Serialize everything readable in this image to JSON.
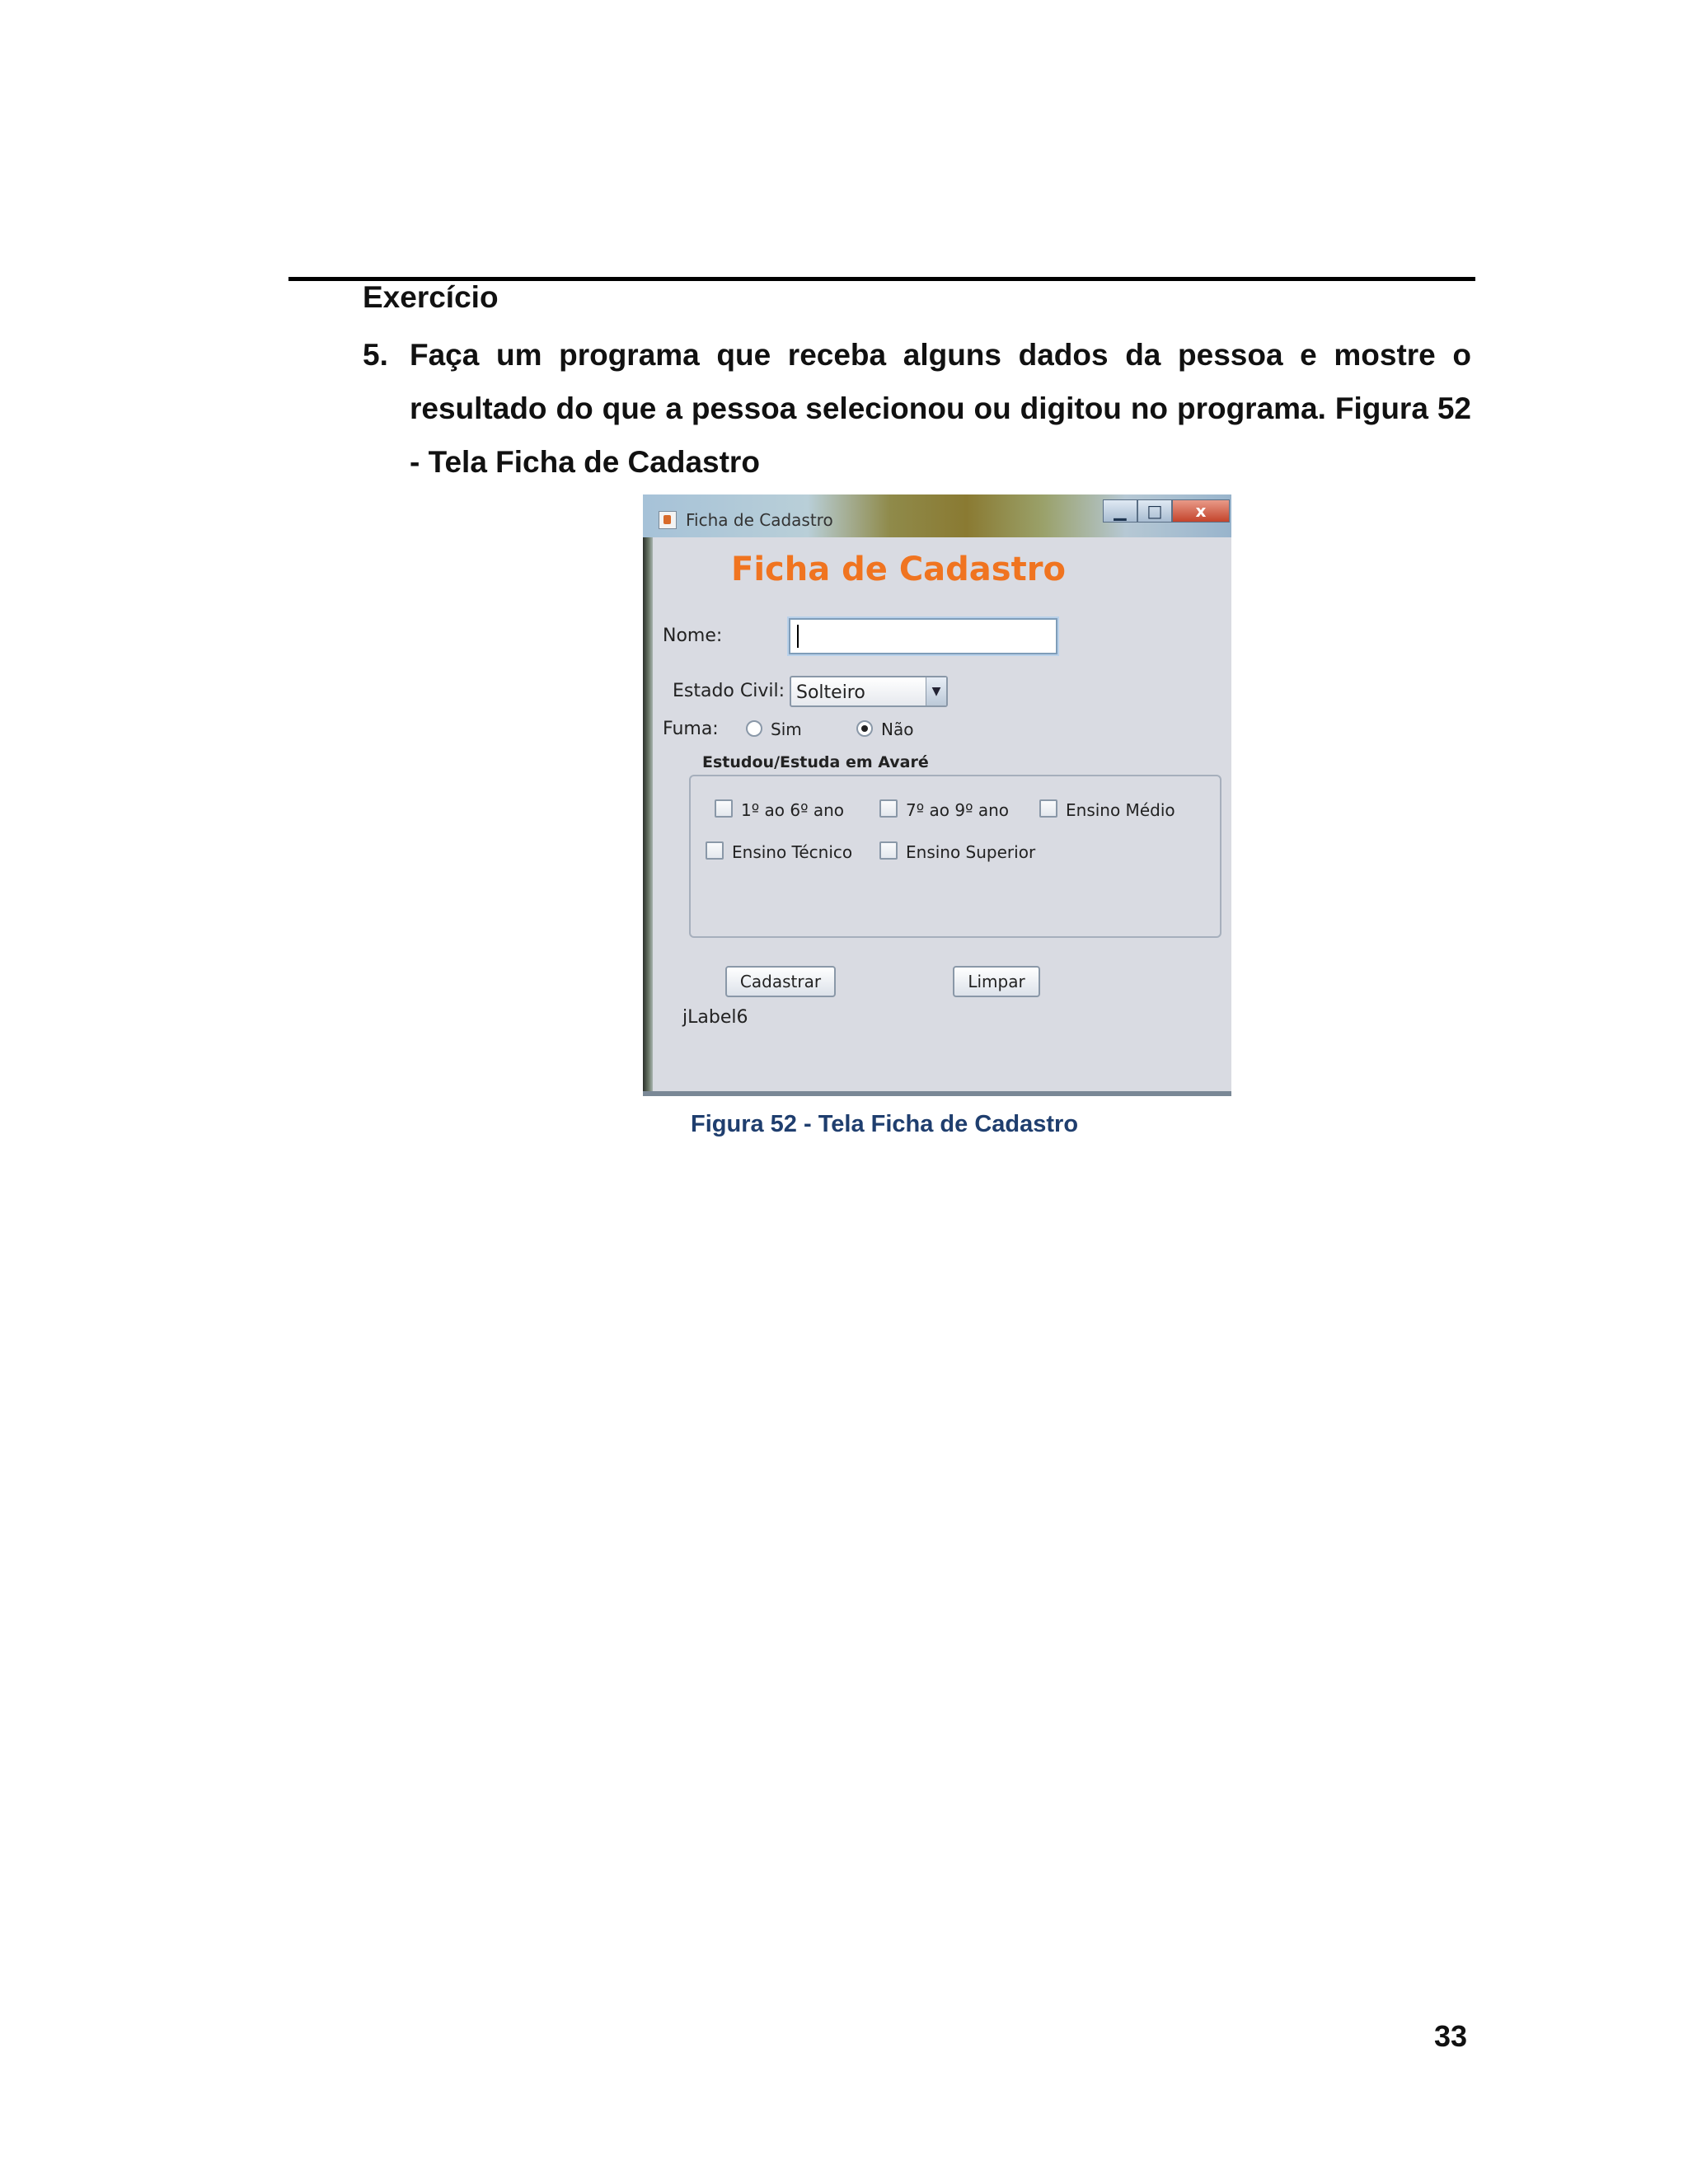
{
  "document": {
    "heading": "Exercício",
    "exercise_number": "5.",
    "exercise_text": "Faça um programa que receba alguns dados da pessoa e mostre o resultado do que a pessoa selecionou ou digitou no programa. Figura 52 - Tela Ficha de Cadastro",
    "caption": "Figura 52 - Tela Ficha de Cadastro",
    "page_number": "33"
  },
  "window": {
    "title": "Ficha de Cadastro",
    "controls": {
      "minimize": "▁",
      "maximize": "□",
      "close": "x"
    }
  },
  "form": {
    "title": "Ficha de Cadastro",
    "nome_label": "Nome:",
    "nome_value": "",
    "estado_civil_label": "Estado Civil:",
    "estado_civil_value": "Solteiro",
    "fuma_label": "Fuma:",
    "fuma_options": [
      "Sim",
      "Não"
    ],
    "fuma_selected": "Não",
    "group_title": "Estudou/Estuda em Avaré",
    "checkboxes": [
      "1º ao 6º ano",
      "7º ao 9º ano",
      "Ensino Médio",
      "Ensino Técnico",
      "Ensino Superior"
    ],
    "buttons": {
      "cadastrar": "Cadastrar",
      "limpar": "Limpar"
    },
    "result_label": "jLabel6"
  },
  "colors": {
    "form_title": "#f07420",
    "caption": "#1f3e6e"
  }
}
